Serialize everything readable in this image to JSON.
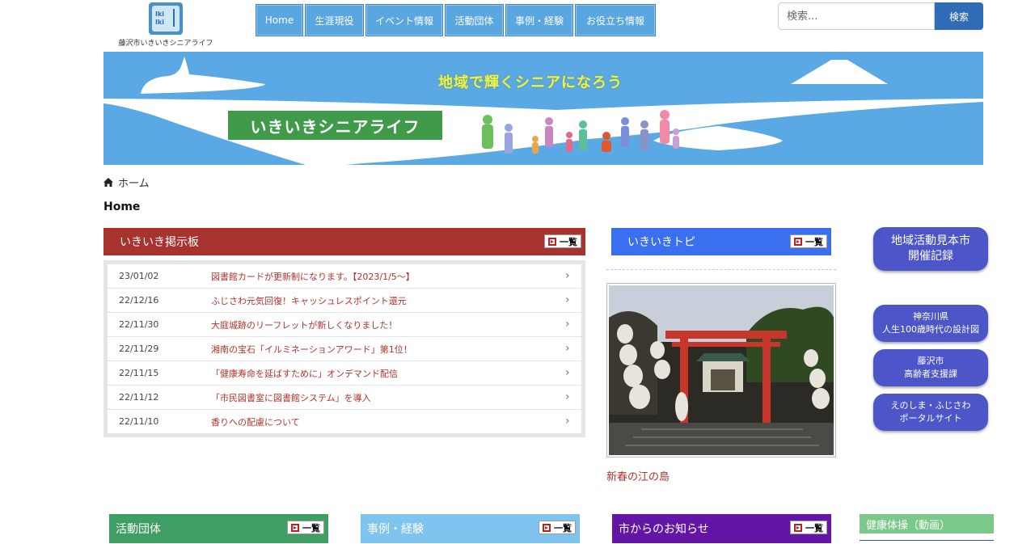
{
  "logo": {
    "mark_text_1": "Iki",
    "mark_text_2": "Iki",
    "site_name": "藤沢市いきいきシニアライフ"
  },
  "nav": {
    "items": [
      {
        "label": "Home"
      },
      {
        "label": "生涯現役"
      },
      {
        "label": "イベント情報"
      },
      {
        "label": "活動団体"
      },
      {
        "label": "事例・経験"
      },
      {
        "label": "お役立ち情報"
      }
    ]
  },
  "search": {
    "placeholder": "検索...",
    "button_label": "検索"
  },
  "banner": {
    "slogan": "地域で輝くシニアになろう",
    "title": "いきいきシニアライフ"
  },
  "breadcrumb": {
    "home_label": "ホーム"
  },
  "page_title": "Home",
  "board": {
    "title": "いきいき掲示板",
    "list_label": "一覧",
    "rows": [
      {
        "date": "23/01/02",
        "title": "図書館カードが更新制になります。【2023/1/5〜】"
      },
      {
        "date": "22/12/16",
        "title": "ふじさわ元気回復！キャッシュレスポイント還元"
      },
      {
        "date": "22/11/30",
        "title": "大庭城跡のリーフレットが新しくなりました！"
      },
      {
        "date": "22/11/29",
        "title": "湘南の宝石「イルミネーションアワード」第1位！"
      },
      {
        "date": "22/11/15",
        "title": "「健康寿命を延ばすために」オンデマンド配信"
      },
      {
        "date": "22/11/12",
        "title": "「市民図書室に図書館システム」を導入"
      },
      {
        "date": "22/11/10",
        "title": "香りへの配慮について"
      }
    ]
  },
  "topics": {
    "title": "いきいきトピ",
    "list_label": "一覧",
    "caption": "新春の江の島"
  },
  "side": {
    "big": {
      "line1": "地域活動見本市",
      "line2": "開催記録"
    },
    "links": [
      {
        "line1": "神奈川県",
        "line2": "人生100歳時代の設計図"
      },
      {
        "line1": "藤沢市",
        "line2": "高齢者支援課"
      },
      {
        "line1": "えのしま・ふじさわ",
        "line2": "ポータルサイト"
      }
    ]
  },
  "bottom": {
    "groups": {
      "title": "活動団体",
      "list_label": "一覧"
    },
    "cases": {
      "title": "事例・経験",
      "list_label": "一覧"
    },
    "city": {
      "title": "市からのお知らせ",
      "list_label": "一覧"
    },
    "health": {
      "title": "健康体操（動画）"
    }
  },
  "colors": {
    "nav": "#5aa6e0",
    "board": "#a8322d",
    "topics": "#3a6ff0",
    "side": "#4c56c9",
    "search_button": "#2f6bb7"
  }
}
